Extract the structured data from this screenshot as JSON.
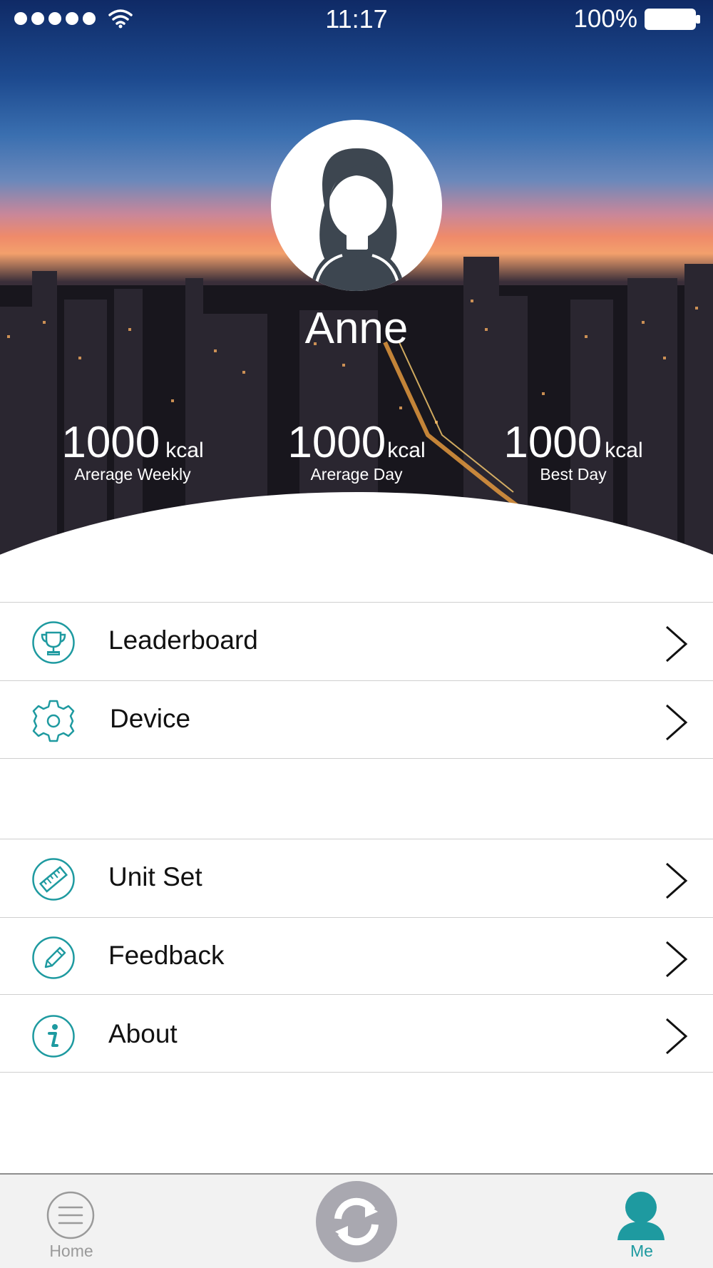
{
  "status_bar": {
    "time": "11:17",
    "battery": "100%"
  },
  "profile": {
    "name": "Anne"
  },
  "stats": [
    {
      "value": "1000",
      "unit": "kcal",
      "label": "Arerage Weekly"
    },
    {
      "value": "1000",
      "unit": "kcal",
      "label": "Arerage Day"
    },
    {
      "value": "1000",
      "unit": "kcal",
      "label": "Best Day"
    }
  ],
  "menu": {
    "group1": [
      {
        "label": "Leaderboard",
        "icon": "trophy-icon"
      },
      {
        "label": "Device",
        "icon": "gear-icon"
      }
    ],
    "group2": [
      {
        "label": "Unit Set",
        "icon": "ruler-icon"
      },
      {
        "label": "Feedback",
        "icon": "pencil-icon"
      },
      {
        "label": "About",
        "icon": "info-icon"
      }
    ]
  },
  "tabs": {
    "home_label": "Home",
    "me_label": "Me",
    "sync_icon": "sync-icon"
  },
  "colors": {
    "accent": "#1e9aa0",
    "tab_inactive": "#9a9a9a",
    "sync_button": "#a9a8b0"
  }
}
